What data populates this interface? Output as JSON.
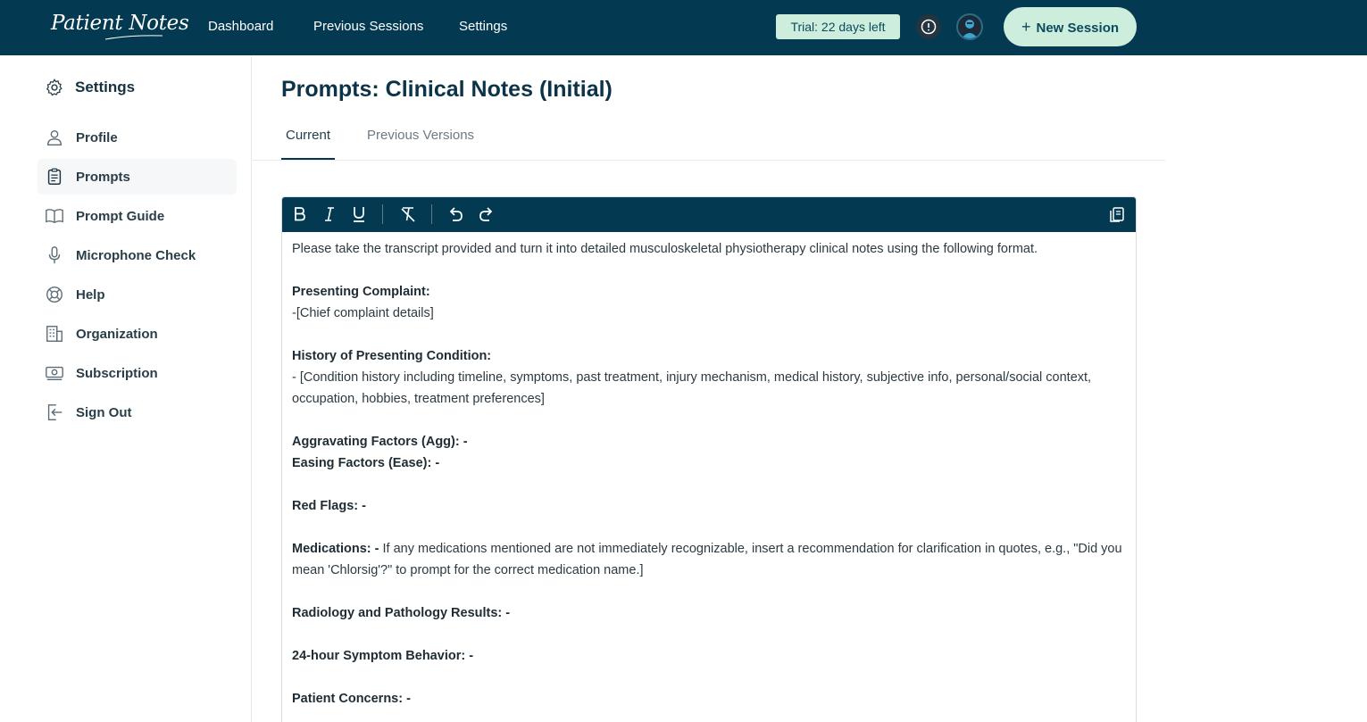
{
  "app": {
    "logo_text": "Patient Notes"
  },
  "nav": {
    "links": [
      "Dashboard",
      "Previous Sessions",
      "Settings"
    ],
    "trial_badge": "Trial: 22 days left",
    "new_session_label": "New Session"
  },
  "sidebar": {
    "heading": "Settings",
    "items": [
      {
        "label": "Profile",
        "icon": "user-icon"
      },
      {
        "label": "Prompts",
        "icon": "clipboard-icon",
        "active": true
      },
      {
        "label": "Prompt Guide",
        "icon": "book-icon"
      },
      {
        "label": "Microphone Check",
        "icon": "microphone-icon"
      },
      {
        "label": "Help",
        "icon": "lifebuoy-icon"
      },
      {
        "label": "Organization",
        "icon": "building-icon"
      },
      {
        "label": "Subscription",
        "icon": "banknote-icon"
      },
      {
        "label": "Sign Out",
        "icon": "sign-out-icon"
      }
    ]
  },
  "main": {
    "title": "Prompts: Clinical Notes (Initial)",
    "tabs": {
      "current": "Current",
      "previous": "Previous Versions"
    }
  },
  "editor": {
    "toolbar_icons": [
      "bold-icon",
      "italic-icon",
      "underline-icon",
      "clear-format-icon",
      "undo-icon",
      "redo-icon",
      "copy-icon"
    ],
    "lines": {
      "l1": "Please take the transcript provided and turn it into detailed musculoskeletal physiotherapy clinical notes using the following format.",
      "presenting_h": "Presenting Complaint:",
      "presenting_t": "-[Chief complaint details]",
      "history_h": "History of Presenting Condition:",
      "history_t": "- [Condition history including timeline, symptoms, past treatment, injury mechanism, medical history, subjective info, personal/social context, occupation, hobbies, treatment preferences]",
      "agg_h": "Aggravating Factors (Agg): -",
      "ease_h": "Easing Factors (Ease): -",
      "red_h": "Red Flags: -",
      "med_h": "Medications: -",
      "med_t": " If any medications mentioned are not immediately recognizable, insert a recommendation for clarification in quotes, e.g., \"Did you mean 'Chlorsig'?\" to prompt for the correct medication name.]",
      "radio_h": "Radiology and Pathology Results: -",
      "symptom_h": "24-hour Symptom Behavior: -",
      "concerns_h": "Patient Concerns: -"
    }
  }
}
